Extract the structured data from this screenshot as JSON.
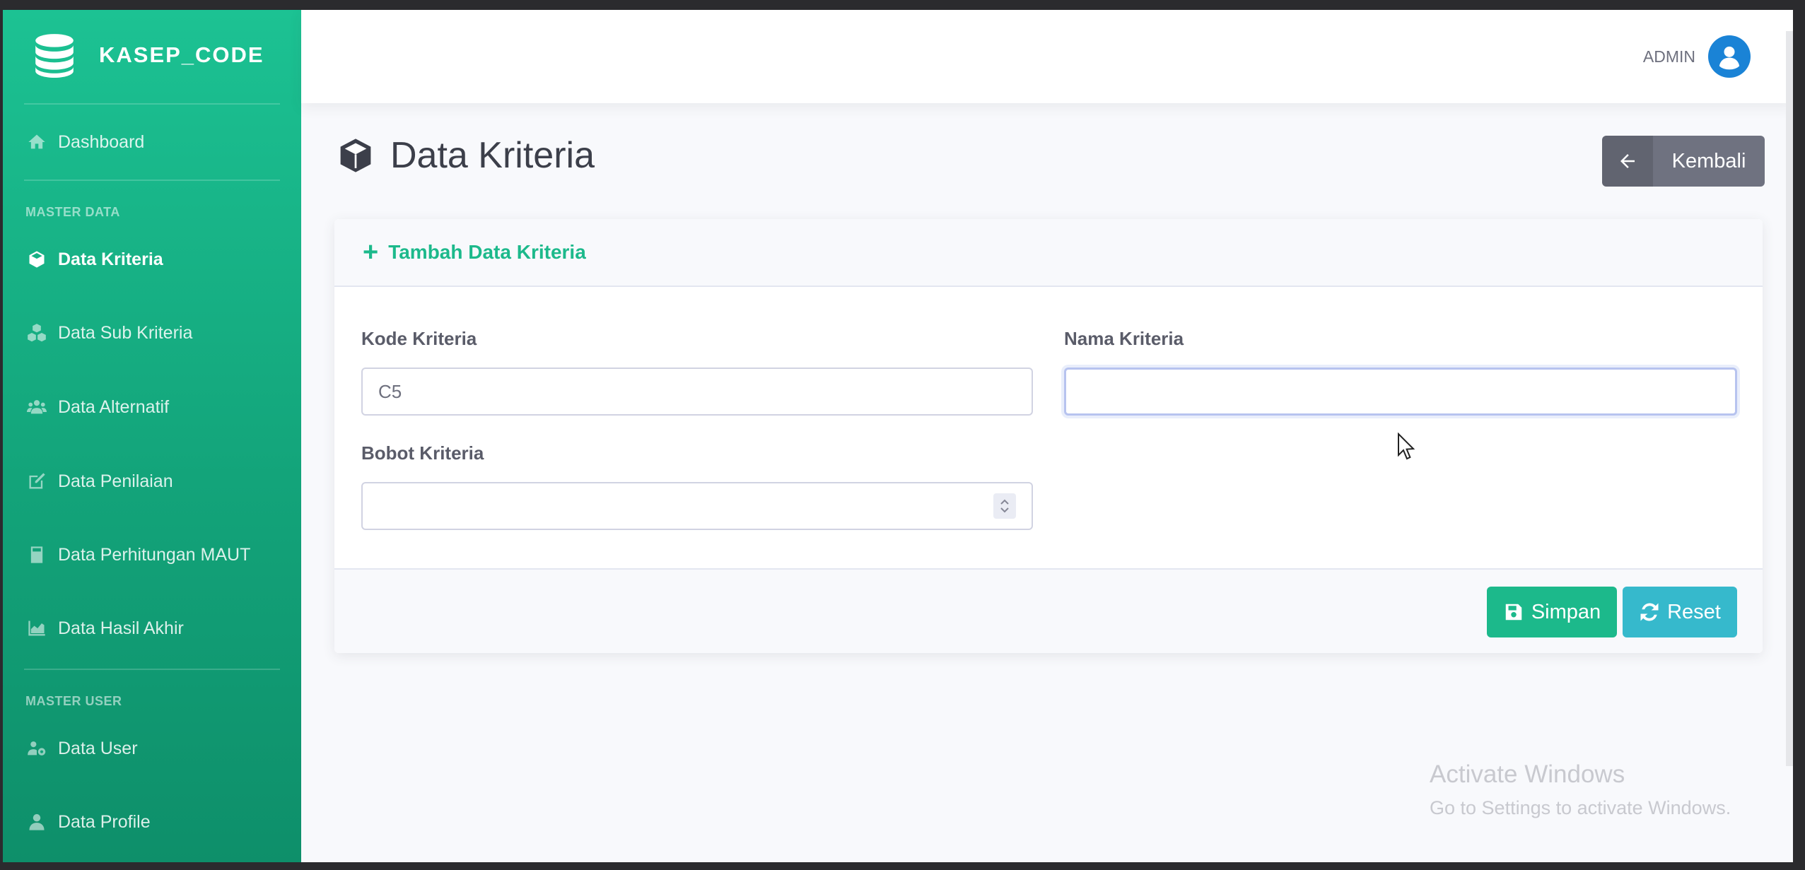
{
  "brand": {
    "name": "KASEP_CODE",
    "icon": "database-icon"
  },
  "sidebar": {
    "dashboard": {
      "label": "Dashboard",
      "icon": "home-icon"
    },
    "section_master_data": "MASTER DATA",
    "items": [
      {
        "label": "Data Kriteria",
        "icon": "cube-icon",
        "active": true
      },
      {
        "label": "Data Sub Kriteria",
        "icon": "cubes-icon",
        "active": false
      },
      {
        "label": "Data Alternatif",
        "icon": "users-icon",
        "active": false
      },
      {
        "label": "Data Penilaian",
        "icon": "edit-icon",
        "active": false
      },
      {
        "label": "Data Perhitungan MAUT",
        "icon": "calculator-icon",
        "active": false
      },
      {
        "label": "Data Hasil Akhir",
        "icon": "chart-area-icon",
        "active": false
      }
    ],
    "section_master_user": "MASTER USER",
    "user_items": [
      {
        "label": "Data User",
        "icon": "users-cog-icon"
      },
      {
        "label": "Data Profile",
        "icon": "user-icon"
      }
    ]
  },
  "topbar": {
    "user_name": "ADMIN",
    "avatar_icon": "user-circle-icon"
  },
  "page": {
    "title": "Data Kriteria",
    "title_icon": "cube-icon",
    "back_button": "Kembali"
  },
  "form": {
    "header": "Tambah Data Kriteria",
    "kode_label": "Kode Kriteria",
    "kode_value": "C5",
    "nama_label": "Nama Kriteria",
    "nama_value": "",
    "bobot_label": "Bobot Kriteria",
    "bobot_value": "",
    "save_button": "Simpan",
    "reset_button": "Reset"
  },
  "watermark": {
    "line1": "Activate Windows",
    "line2": "Go to Settings to activate Windows."
  },
  "colors": {
    "sidebar": "#1cc293",
    "accent": "#1cb98b",
    "info": "#36b9cc",
    "secondary": "#6f7280"
  }
}
